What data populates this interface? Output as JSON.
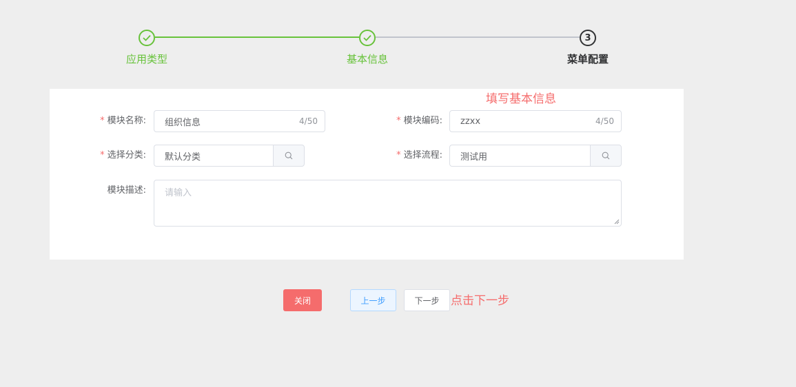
{
  "steps": [
    {
      "title": "应用类型",
      "status": "done"
    },
    {
      "title": "基本信息",
      "status": "done"
    },
    {
      "title": "菜单配置",
      "status": "current",
      "number": "3"
    }
  ],
  "annotations": {
    "fill_info": "填写基本信息",
    "click_next": "点击下一步"
  },
  "form": {
    "required_mark": "*",
    "module_name": {
      "label": "模块名称:",
      "value": "组织信息",
      "count": "4/50"
    },
    "module_code": {
      "label": "模块编码:",
      "value": "zzxx",
      "count": "4/50"
    },
    "category": {
      "label": "选择分类:",
      "value": "默认分类"
    },
    "flow": {
      "label": "选择流程:",
      "value": "测试用"
    },
    "description": {
      "label": "模块描述:",
      "placeholder": "请输入"
    }
  },
  "buttons": {
    "close": "关闭",
    "prev": "上一步",
    "next": "下一步"
  },
  "colors": {
    "done": "#67c23a",
    "current": "#303133",
    "danger": "#f56c6c",
    "primary": "#409eff"
  }
}
